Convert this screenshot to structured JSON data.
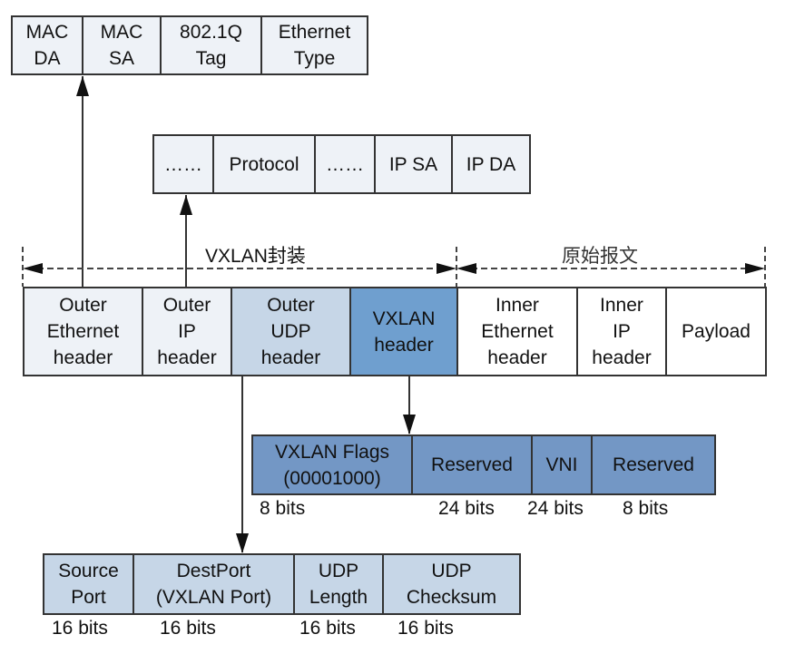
{
  "ethernet_header": {
    "fields": [
      "MAC\nDA",
      "MAC\nSA",
      "802.1Q\nTag",
      "Ethernet\nType"
    ]
  },
  "ip_header": {
    "fields": [
      "……",
      "Protocol",
      "……",
      "IP SA",
      "IP DA"
    ]
  },
  "spans": {
    "encapsulation": "VXLAN封装",
    "original": "原始报文"
  },
  "packet": {
    "fields": [
      "Outer\nEthernet\nheader",
      "Outer\nIP\nheader",
      "Outer\nUDP\nheader",
      "VXLAN\nheader",
      "Inner\nEthernet\nheader",
      "Inner\nIP\nheader",
      "Payload"
    ]
  },
  "vxlan_header": {
    "fields": [
      "VXLAN Flags\n(00001000)",
      "Reserved",
      "VNI",
      "Reserved"
    ],
    "bits": [
      "8 bits",
      "24 bits",
      "24 bits",
      "8 bits"
    ]
  },
  "udp_header": {
    "fields": [
      "Source\nPort",
      "DestPort\n(VXLAN Port)",
      "UDP\nLength",
      "UDP\nChecksum"
    ],
    "bits": [
      "16 bits",
      "16 bits",
      "16 bits",
      "16 bits"
    ]
  },
  "colors": {
    "light_fill": "#eef2f7",
    "udp_fill": "#c6d6e7",
    "vxlan_fill": "#6f9fcf",
    "vxlan_detail_fill": "#7397c5"
  }
}
